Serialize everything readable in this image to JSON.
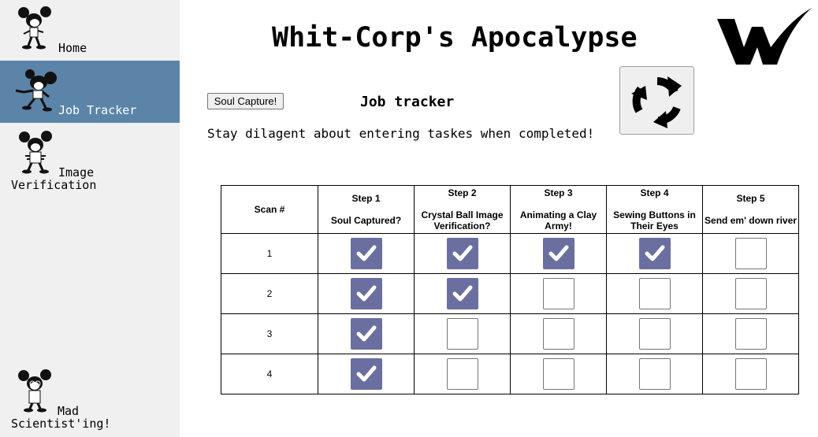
{
  "app": {
    "title": "Whit-Corp's Apocalypse"
  },
  "sidebar": {
    "items": [
      {
        "label": "Home",
        "active": false
      },
      {
        "label": "Job Tracker",
        "active": true
      },
      {
        "label": "Image\nVerification",
        "active": false
      },
      {
        "label": "Mad\nScientist'ing!",
        "active": false
      }
    ]
  },
  "main": {
    "soul_capture_label": "Soul Capture!",
    "section_title": "Job tracker",
    "subtitle": "Stay dilagent about entering taskes when completed!",
    "table": {
      "headers": [
        {
          "step": "",
          "label": "Scan #"
        },
        {
          "step": "Step 1",
          "label": "Soul Captured?"
        },
        {
          "step": "Step 2",
          "label": "Crystal Ball Image Verification?"
        },
        {
          "step": "Step 3",
          "label": "Animating a Clay Army!"
        },
        {
          "step": "Step 4",
          "label": "Sewing Buttons in Their Eyes"
        },
        {
          "step": "Step 5",
          "label": "Send em' down river"
        }
      ],
      "rows": [
        {
          "scan": "1",
          "steps": [
            true,
            true,
            true,
            true,
            false
          ]
        },
        {
          "scan": "2",
          "steps": [
            true,
            true,
            false,
            false,
            false
          ]
        },
        {
          "scan": "3",
          "steps": [
            true,
            false,
            false,
            false,
            false
          ]
        },
        {
          "scan": "4",
          "steps": [
            true,
            false,
            false,
            false,
            false
          ]
        }
      ]
    }
  },
  "colors": {
    "sidebar_bg": "#f0f0f0",
    "active_nav": "#5b84a8",
    "checked": "#6b6fa0"
  },
  "icons": {
    "logo": "w-check-logo",
    "refresh": "refresh-icon",
    "mascot": "mouse-mascot-icon"
  }
}
